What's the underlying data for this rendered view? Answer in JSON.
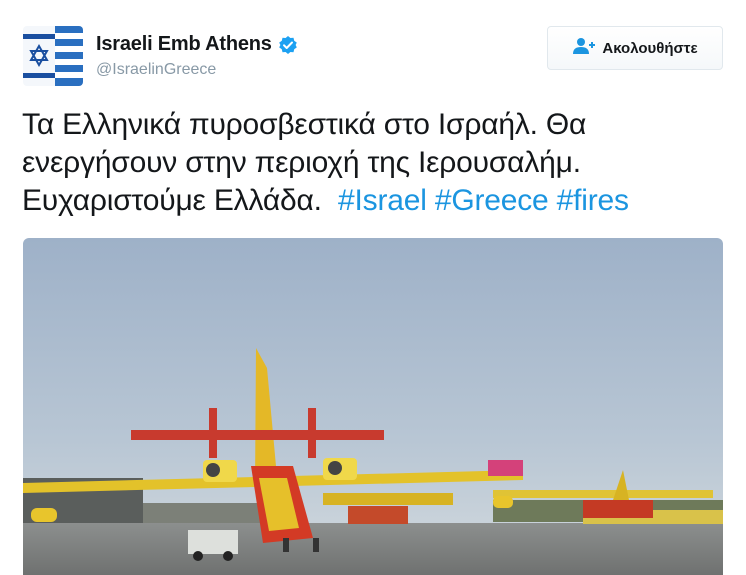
{
  "account": {
    "display_name": "Israeli Emb Athens",
    "handle": "@IsraelinGreece",
    "verified": true,
    "avatar_icon": "israel-flag-greece-flag-avatar"
  },
  "follow_button": {
    "label": "Ακολουθήστε",
    "icon": "add-user-icon"
  },
  "tweet": {
    "line1": "Τα Ελληνικά πυροσβεστικά στο Ισραήλ. Θα",
    "line2": "ενεργήσουν στην περιοχή της Ιερουσαλήμ.",
    "line3_text": "Ευχαριστούμε Ελλάδα.",
    "hashtags": [
      "#Israel",
      "#Greece",
      "#fires"
    ]
  },
  "media": {
    "type": "photo",
    "subject": "firefighting-aircraft-on-tarmac"
  },
  "colors": {
    "link": "#1b95e0",
    "verified": "#1da1f2",
    "secondary_text": "#8899a6"
  }
}
